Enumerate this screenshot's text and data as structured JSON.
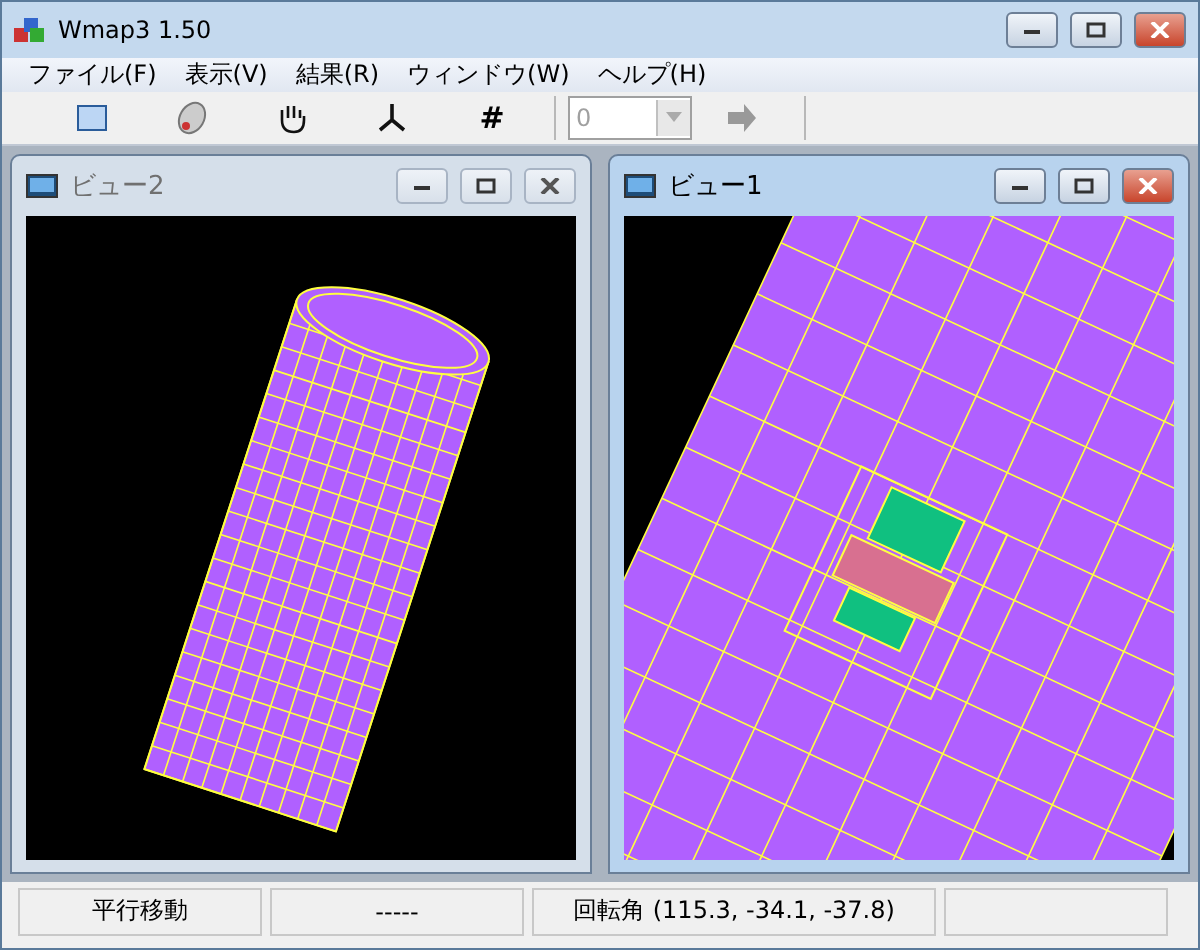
{
  "window": {
    "title": "Wmap3 1.50"
  },
  "menu": [
    "ファイル(F)",
    "表示(V)",
    "結果(R)",
    "ウィンドウ(W)",
    "ヘルプ(H)"
  ],
  "toolbar": [
    {
      "kind": "frame"
    },
    {
      "kind": "mouse"
    },
    {
      "kind": "hand"
    },
    {
      "kind": "axes"
    },
    {
      "kind": "text",
      "label": "#"
    },
    {
      "kind": "separator"
    },
    {
      "kind": "combo",
      "value": "0",
      "disabled": true
    },
    {
      "kind": "arrow",
      "disabled": true
    },
    {
      "kind": "separator"
    }
  ],
  "views": [
    {
      "title": "ビュー2",
      "active": false,
      "kind": "cylinder"
    },
    {
      "title": "ビュー1",
      "active": true,
      "kind": "closeup"
    }
  ],
  "status_bar": [
    "平行移動",
    "-----",
    "回転角 (115.3, -34.1, -37.8)"
  ]
}
